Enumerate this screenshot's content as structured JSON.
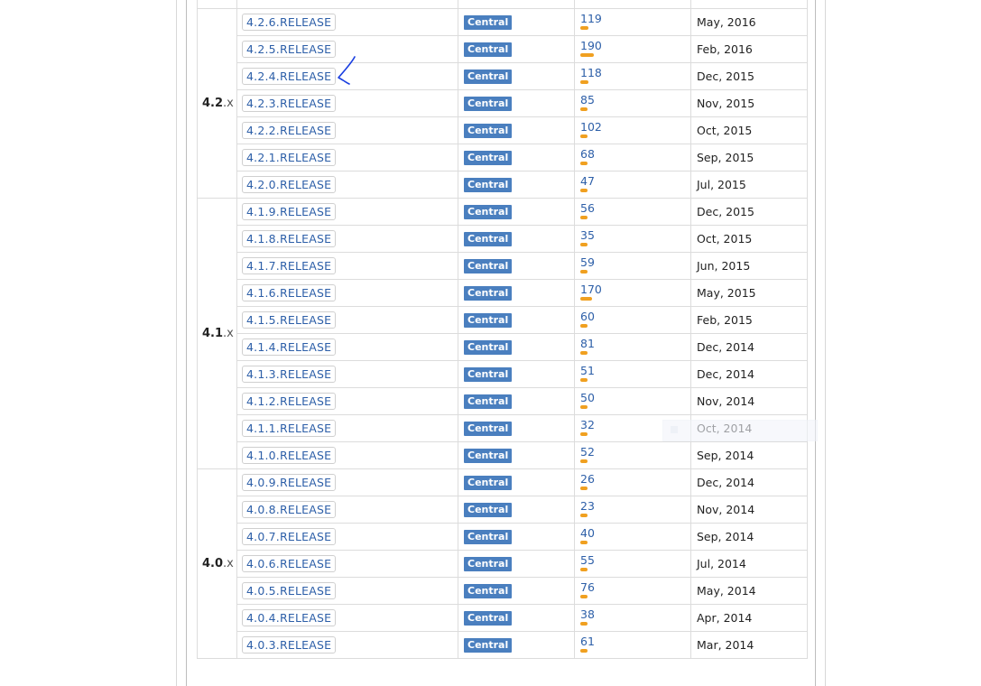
{
  "table": {
    "repository_label": "Central",
    "groups": [
      {
        "number": "4.2",
        "suffix": ".x",
        "rows": [
          {
            "version": "4.2.6.RELEASE",
            "usages": 119,
            "date": "May, 2016"
          },
          {
            "version": "4.2.5.RELEASE",
            "usages": 190,
            "date": "Feb, 2016"
          },
          {
            "version": "4.2.4.RELEASE",
            "usages": 118,
            "date": "Dec, 2015"
          },
          {
            "version": "4.2.3.RELEASE",
            "usages": 85,
            "date": "Nov, 2015"
          },
          {
            "version": "4.2.2.RELEASE",
            "usages": 102,
            "date": "Oct, 2015"
          },
          {
            "version": "4.2.1.RELEASE",
            "usages": 68,
            "date": "Sep, 2015"
          },
          {
            "version": "4.2.0.RELEASE",
            "usages": 47,
            "date": "Jul, 2015"
          }
        ]
      },
      {
        "number": "4.1",
        "suffix": ".x",
        "rows": [
          {
            "version": "4.1.9.RELEASE",
            "usages": 56,
            "date": "Dec, 2015"
          },
          {
            "version": "4.1.8.RELEASE",
            "usages": 35,
            "date": "Oct, 2015"
          },
          {
            "version": "4.1.7.RELEASE",
            "usages": 59,
            "date": "Jun, 2015"
          },
          {
            "version": "4.1.6.RELEASE",
            "usages": 170,
            "date": "May, 2015"
          },
          {
            "version": "4.1.5.RELEASE",
            "usages": 60,
            "date": "Feb, 2015"
          },
          {
            "version": "4.1.4.RELEASE",
            "usages": 81,
            "date": "Dec, 2014"
          },
          {
            "version": "4.1.3.RELEASE",
            "usages": 51,
            "date": "Dec, 2014"
          },
          {
            "version": "4.1.2.RELEASE",
            "usages": 50,
            "date": "Nov, 2014"
          },
          {
            "version": "4.1.1.RELEASE",
            "usages": 32,
            "date": "Oct, 2014"
          },
          {
            "version": "4.1.0.RELEASE",
            "usages": 52,
            "date": "Sep, 2014"
          }
        ]
      },
      {
        "number": "4.0",
        "suffix": ".x",
        "rows": [
          {
            "version": "4.0.9.RELEASE",
            "usages": 26,
            "date": "Dec, 2014"
          },
          {
            "version": "4.0.8.RELEASE",
            "usages": 23,
            "date": "Nov, 2014"
          },
          {
            "version": "4.0.7.RELEASE",
            "usages": 40,
            "date": "Sep, 2014"
          },
          {
            "version": "4.0.6.RELEASE",
            "usages": 55,
            "date": "Jul, 2014"
          },
          {
            "version": "4.0.5.RELEASE",
            "usages": 76,
            "date": "May, 2014"
          },
          {
            "version": "4.0.4.RELEASE",
            "usages": 38,
            "date": "Apr, 2014"
          },
          {
            "version": "4.0.3.RELEASE",
            "usages": 61,
            "date": "Mar, 2014"
          }
        ]
      }
    ]
  },
  "colors": {
    "link": "#2d5fa8",
    "repo_badge": "#4a7fbf",
    "usage_bar": "#f0a020",
    "annotation_ink": "#1a3fe0"
  },
  "annotation": {
    "icon": "hand-drawn-arrow-icon"
  }
}
